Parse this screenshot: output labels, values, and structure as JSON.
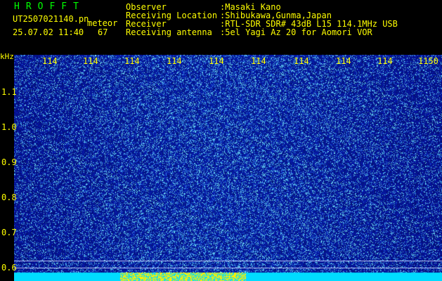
{
  "header": {
    "app_title": "HROFFT",
    "filename": "UT2507021140.pn",
    "meteor_label": "meteor",
    "datetime": "25.07.02 11:40",
    "count": "67"
  },
  "info": [
    {
      "label": "Observer",
      "value": ":Masaki Kano"
    },
    {
      "label": "Receiving Location",
      "value": ":Shibukawa,Gunma,Japan"
    },
    {
      "label": "Receiver",
      "value": ":RTL-SDR SDR# 43dB L15 114.1MHz USB"
    },
    {
      "label": "Receiving antenna",
      "value": ":5el Yagi Az 20 for Aomori VOR"
    }
  ],
  "axes": {
    "unit_label": "kHz",
    "x_ticks": [
      "114",
      "114",
      "114",
      "114",
      "114",
      "114",
      "114",
      "114",
      "114",
      "1150"
    ],
    "y_ticks": [
      "1.1",
      "1.0",
      "0.9",
      "0.8",
      "0.7",
      "0.6"
    ]
  },
  "colors": {
    "background": "#000000",
    "text_yellow": "#ffff00",
    "title_green": "#00ff00",
    "spectrum_base": "#0a1a9e",
    "spectrum_noise": "#6ad0ff",
    "bottom_band": "#00e5ff",
    "bottom_band_hot": "#ffff00"
  }
}
